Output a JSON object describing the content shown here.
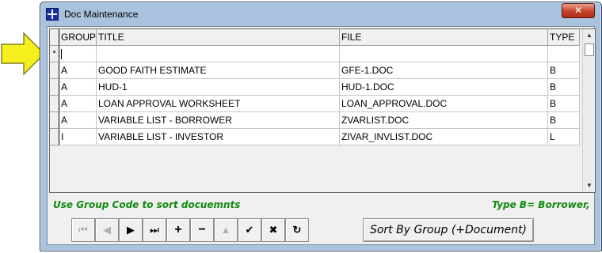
{
  "window": {
    "title": "Doc Maintenance",
    "close_glyph": "✕"
  },
  "grid": {
    "columns": [
      "GROUP",
      "TITLE",
      "FILE",
      "TYPE"
    ],
    "new_row_marker": "*",
    "rows": [
      {
        "group": "A",
        "title": "GOOD FAITH ESTIMATE",
        "file": "GFE-1.DOC",
        "type": "B"
      },
      {
        "group": "A",
        "title": "HUD-1",
        "file": "HUD-1.DOC",
        "type": "B"
      },
      {
        "group": "A",
        "title": "LOAN APPROVAL WORKSHEET",
        "file": "LOAN_APPROVAL.DOC",
        "type": "B"
      },
      {
        "group": "A",
        "title": "VARIABLE LIST - BORROWER",
        "file": "ZVARLIST.DOC",
        "type": "B"
      },
      {
        "group": "I",
        "title": "VARIABLE LIST - INVESTOR",
        "file": "ZIVAR_INVLIST.DOC",
        "type": "L"
      }
    ],
    "scroll_up_glyph": "▲",
    "scroll_down_glyph": "▼"
  },
  "hints": {
    "left": "Use Group Code to sort docuemnts",
    "right": "Type B= Borrower,"
  },
  "navigator": {
    "buttons": [
      {
        "name": "first-record",
        "glyph": "⏮",
        "enabled": false
      },
      {
        "name": "prior-record",
        "glyph": "◀",
        "enabled": false
      },
      {
        "name": "next-record",
        "glyph": "▶",
        "enabled": true
      },
      {
        "name": "last-record",
        "glyph": "⏭",
        "enabled": true
      },
      {
        "name": "insert-record",
        "glyph": "+",
        "enabled": true
      },
      {
        "name": "delete-record",
        "glyph": "−",
        "enabled": true
      },
      {
        "name": "edit-record",
        "glyph": "▲",
        "enabled": false
      },
      {
        "name": "post-record",
        "glyph": "✔",
        "enabled": true
      },
      {
        "name": "cancel-edit",
        "glyph": "✖",
        "enabled": true
      },
      {
        "name": "refresh-data",
        "glyph": "↻",
        "enabled": true
      }
    ]
  },
  "sort_button": {
    "label": "Sort By Group (+Document)"
  },
  "colors": {
    "pointer_arrow": "#f6ef1e",
    "hint_text": "#118a11",
    "close_button": "#c7422b"
  }
}
